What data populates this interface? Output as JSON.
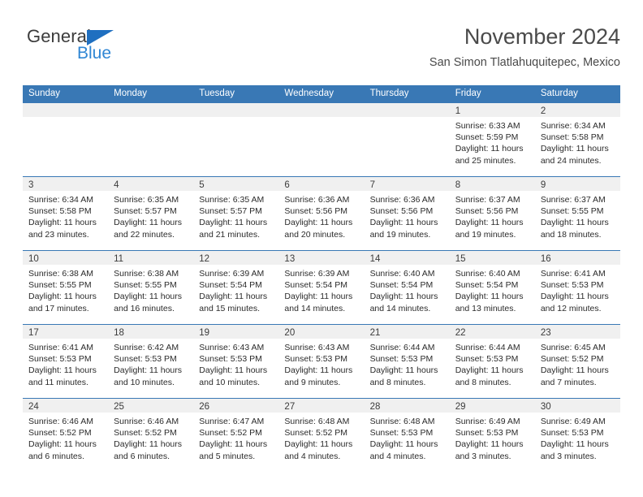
{
  "brand": {
    "name_top": "General",
    "name_bottom": "Blue",
    "triangle_color": "#1f6fc0",
    "blue_color": "#2f86d4"
  },
  "header": {
    "title": "November 2024",
    "subtitle": "San Simon Tlatlahuquitepec, Mexico"
  },
  "theme": {
    "header_row_bg": "#3978b5",
    "daynum_strip_bg": "#f0f0f0",
    "text_color": "#2b2b2b"
  },
  "calendar": {
    "weekdays": [
      "Sunday",
      "Monday",
      "Tuesday",
      "Wednesday",
      "Thursday",
      "Friday",
      "Saturday"
    ],
    "weeks": [
      [
        {
          "day": "",
          "lines": []
        },
        {
          "day": "",
          "lines": []
        },
        {
          "day": "",
          "lines": []
        },
        {
          "day": "",
          "lines": []
        },
        {
          "day": "",
          "lines": []
        },
        {
          "day": "1",
          "lines": [
            "Sunrise: 6:33 AM",
            "Sunset: 5:59 PM",
            "Daylight: 11 hours",
            "and 25 minutes."
          ]
        },
        {
          "day": "2",
          "lines": [
            "Sunrise: 6:34 AM",
            "Sunset: 5:58 PM",
            "Daylight: 11 hours",
            "and 24 minutes."
          ]
        }
      ],
      [
        {
          "day": "3",
          "lines": [
            "Sunrise: 6:34 AM",
            "Sunset: 5:58 PM",
            "Daylight: 11 hours",
            "and 23 minutes."
          ]
        },
        {
          "day": "4",
          "lines": [
            "Sunrise: 6:35 AM",
            "Sunset: 5:57 PM",
            "Daylight: 11 hours",
            "and 22 minutes."
          ]
        },
        {
          "day": "5",
          "lines": [
            "Sunrise: 6:35 AM",
            "Sunset: 5:57 PM",
            "Daylight: 11 hours",
            "and 21 minutes."
          ]
        },
        {
          "day": "6",
          "lines": [
            "Sunrise: 6:36 AM",
            "Sunset: 5:56 PM",
            "Daylight: 11 hours",
            "and 20 minutes."
          ]
        },
        {
          "day": "7",
          "lines": [
            "Sunrise: 6:36 AM",
            "Sunset: 5:56 PM",
            "Daylight: 11 hours",
            "and 19 minutes."
          ]
        },
        {
          "day": "8",
          "lines": [
            "Sunrise: 6:37 AM",
            "Sunset: 5:56 PM",
            "Daylight: 11 hours",
            "and 19 minutes."
          ]
        },
        {
          "day": "9",
          "lines": [
            "Sunrise: 6:37 AM",
            "Sunset: 5:55 PM",
            "Daylight: 11 hours",
            "and 18 minutes."
          ]
        }
      ],
      [
        {
          "day": "10",
          "lines": [
            "Sunrise: 6:38 AM",
            "Sunset: 5:55 PM",
            "Daylight: 11 hours",
            "and 17 minutes."
          ]
        },
        {
          "day": "11",
          "lines": [
            "Sunrise: 6:38 AM",
            "Sunset: 5:55 PM",
            "Daylight: 11 hours",
            "and 16 minutes."
          ]
        },
        {
          "day": "12",
          "lines": [
            "Sunrise: 6:39 AM",
            "Sunset: 5:54 PM",
            "Daylight: 11 hours",
            "and 15 minutes."
          ]
        },
        {
          "day": "13",
          "lines": [
            "Sunrise: 6:39 AM",
            "Sunset: 5:54 PM",
            "Daylight: 11 hours",
            "and 14 minutes."
          ]
        },
        {
          "day": "14",
          "lines": [
            "Sunrise: 6:40 AM",
            "Sunset: 5:54 PM",
            "Daylight: 11 hours",
            "and 14 minutes."
          ]
        },
        {
          "day": "15",
          "lines": [
            "Sunrise: 6:40 AM",
            "Sunset: 5:54 PM",
            "Daylight: 11 hours",
            "and 13 minutes."
          ]
        },
        {
          "day": "16",
          "lines": [
            "Sunrise: 6:41 AM",
            "Sunset: 5:53 PM",
            "Daylight: 11 hours",
            "and 12 minutes."
          ]
        }
      ],
      [
        {
          "day": "17",
          "lines": [
            "Sunrise: 6:41 AM",
            "Sunset: 5:53 PM",
            "Daylight: 11 hours",
            "and 11 minutes."
          ]
        },
        {
          "day": "18",
          "lines": [
            "Sunrise: 6:42 AM",
            "Sunset: 5:53 PM",
            "Daylight: 11 hours",
            "and 10 minutes."
          ]
        },
        {
          "day": "19",
          "lines": [
            "Sunrise: 6:43 AM",
            "Sunset: 5:53 PM",
            "Daylight: 11 hours",
            "and 10 minutes."
          ]
        },
        {
          "day": "20",
          "lines": [
            "Sunrise: 6:43 AM",
            "Sunset: 5:53 PM",
            "Daylight: 11 hours",
            "and 9 minutes."
          ]
        },
        {
          "day": "21",
          "lines": [
            "Sunrise: 6:44 AM",
            "Sunset: 5:53 PM",
            "Daylight: 11 hours",
            "and 8 minutes."
          ]
        },
        {
          "day": "22",
          "lines": [
            "Sunrise: 6:44 AM",
            "Sunset: 5:53 PM",
            "Daylight: 11 hours",
            "and 8 minutes."
          ]
        },
        {
          "day": "23",
          "lines": [
            "Sunrise: 6:45 AM",
            "Sunset: 5:52 PM",
            "Daylight: 11 hours",
            "and 7 minutes."
          ]
        }
      ],
      [
        {
          "day": "24",
          "lines": [
            "Sunrise: 6:46 AM",
            "Sunset: 5:52 PM",
            "Daylight: 11 hours",
            "and 6 minutes."
          ]
        },
        {
          "day": "25",
          "lines": [
            "Sunrise: 6:46 AM",
            "Sunset: 5:52 PM",
            "Daylight: 11 hours",
            "and 6 minutes."
          ]
        },
        {
          "day": "26",
          "lines": [
            "Sunrise: 6:47 AM",
            "Sunset: 5:52 PM",
            "Daylight: 11 hours",
            "and 5 minutes."
          ]
        },
        {
          "day": "27",
          "lines": [
            "Sunrise: 6:48 AM",
            "Sunset: 5:52 PM",
            "Daylight: 11 hours",
            "and 4 minutes."
          ]
        },
        {
          "day": "28",
          "lines": [
            "Sunrise: 6:48 AM",
            "Sunset: 5:53 PM",
            "Daylight: 11 hours",
            "and 4 minutes."
          ]
        },
        {
          "day": "29",
          "lines": [
            "Sunrise: 6:49 AM",
            "Sunset: 5:53 PM",
            "Daylight: 11 hours",
            "and 3 minutes."
          ]
        },
        {
          "day": "30",
          "lines": [
            "Sunrise: 6:49 AM",
            "Sunset: 5:53 PM",
            "Daylight: 11 hours",
            "and 3 minutes."
          ]
        }
      ]
    ]
  }
}
